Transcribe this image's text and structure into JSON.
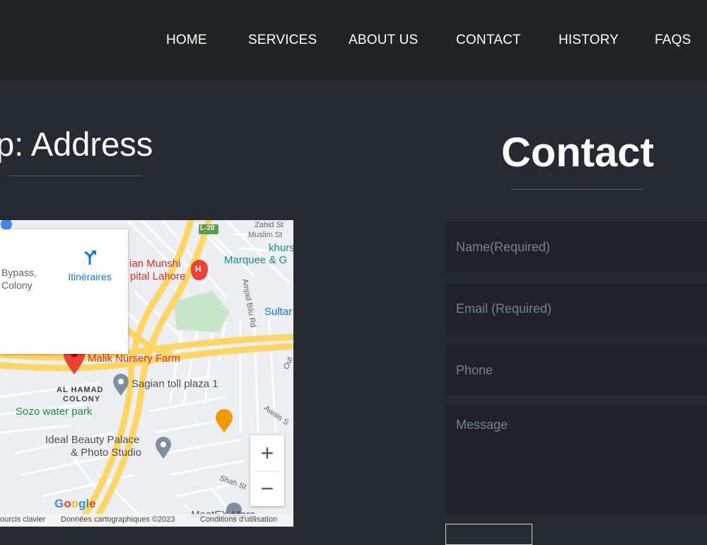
{
  "nav": {
    "items": [
      "HOME",
      "SERVICES",
      "ABOUT US",
      "CONTACT",
      "HISTORY",
      "FAQS"
    ]
  },
  "map_section": {
    "heading": "ap: Address"
  },
  "contact_section": {
    "heading": "Contact",
    "fields": {
      "name_placeholder": "Name(Required)",
      "email_placeholder": "Email (Required)",
      "phone_placeholder": "Phone",
      "message_placeholder": "Message"
    }
  },
  "map": {
    "info_card": {
      "address_line1": "Bypass,",
      "address_line2": "Colony",
      "directions_label": "Itinéraires"
    },
    "labels": {
      "zahid_st": "Zahid St",
      "muslim_st": "Muslim St",
      "road_badge": "L-20",
      "khurs": "khurs",
      "marquee": "Marquee & G",
      "munshi": "ian Munshi",
      "hospital": "pital Lahore",
      "amjad_bilu": "Amjad Bilu Rd",
      "sultan": "Sultar",
      "malik_nursery": "Malik Nursery Farm",
      "al_hamad_1": "AL HAMAD",
      "al_hamad_2": "COLONY",
      "sagian_toll": "Sagian toll plaza 1",
      "sozo": "Sozo water park",
      "awais": "Awais S",
      "out": "Out",
      "ideal_beauty_1": "Ideal Beauty Palace",
      "ideal_beauty_2": "& Photo Studio",
      "shah": "Shah St",
      "meat": "MeatEX Marc",
      "google": "Google"
    },
    "zoom_in": "+",
    "zoom_out": "−",
    "attribution": {
      "shortcuts": "ourcis clavier",
      "map_data": "Données cartographiques ©2023",
      "terms": "Conditions d'utilisation"
    }
  },
  "colors": {
    "page_bg": "#252932",
    "navbar_bg": "#212327",
    "field_bg": "#1f222a",
    "map_road": "#fdd663",
    "map_marker_red": "#ea4335"
  }
}
